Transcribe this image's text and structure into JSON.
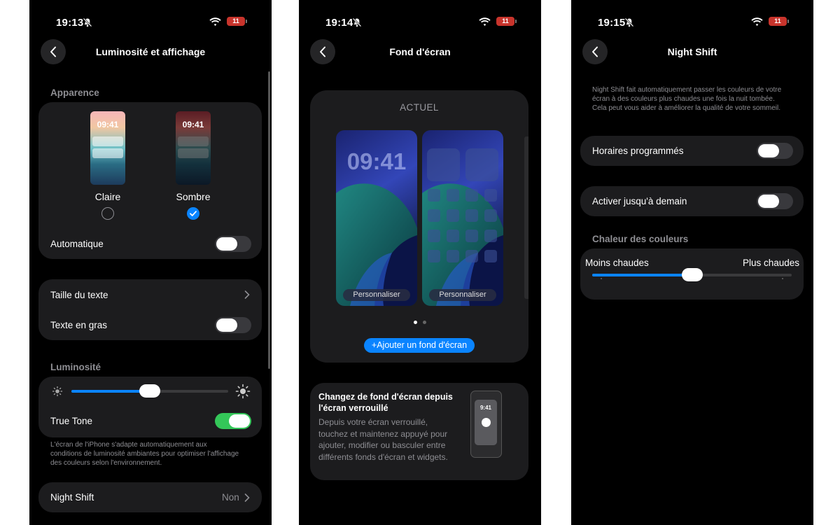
{
  "colors": {
    "accent": "#0a84ff",
    "toggle_on": "#34c759",
    "card_bg": "#1c1c1e",
    "screen_bg": "#000000",
    "battery_low": "#c8342c"
  },
  "icons": [
    "chevron-left-icon",
    "silent-bell-icon",
    "wifi-icon",
    "battery-icon",
    "chevron-right-icon",
    "sun-small-icon",
    "sun-large-icon",
    "checkmark-icon",
    "plus-icon"
  ],
  "screens": [
    {
      "status": {
        "time": "19:13",
        "battery": "11"
      },
      "nav_title": "Luminosité et affichage",
      "appearance": {
        "header": "Apparence",
        "preview_time": "09:41",
        "options": [
          {
            "label": "Claire",
            "selected": false
          },
          {
            "label": "Sombre",
            "selected": true
          }
        ],
        "automatic_label": "Automatique",
        "automatic_on": false
      },
      "text_settings": {
        "text_size_label": "Taille du texte",
        "bold_text_label": "Texte en gras",
        "bold_on": false
      },
      "brightness": {
        "header": "Luminosité",
        "level": 0.5,
        "true_tone_label": "True Tone",
        "true_tone_on": true,
        "footnote": "L'écran de l'iPhone s'adapte automatiquement aux conditions de luminosité ambiantes pour optimiser l'affichage des couleurs selon l'environnement."
      },
      "night_shift": {
        "label": "Night Shift",
        "value": "Non"
      }
    },
    {
      "status": {
        "time": "19:14",
        "battery": "11"
      },
      "nav_title": "Fond d'écran",
      "current_label": "ACTUEL",
      "lock_time": "09:41",
      "customize_label": "Personnaliser",
      "page_count": 2,
      "active_page": 0,
      "add_label": "+Ajouter un fond d'écran",
      "tip": {
        "title": "Changez de fond d'écran depuis l'écran verrouillé",
        "body": "Depuis votre écran verrouillé, touchez et maintenez appuyé pour ajouter, modifier ou basculer entre différents fonds d'écran et widgets.",
        "illustration_time": "9:41"
      }
    },
    {
      "status": {
        "time": "19:15",
        "battery": "11"
      },
      "nav_title": "Night Shift",
      "description": "Night Shift fait automatiquement passer les couleurs de votre écran à des couleurs plus chaudes une fois la nuit tombée. Cela peut vous aider à améliorer la qualité de votre sommeil.",
      "scheduled_label": "Horaires programmés",
      "scheduled_on": false,
      "until_tomorrow_label": "Activer jusqu'à demain",
      "until_tomorrow_on": false,
      "warmth": {
        "header": "Chaleur des couleurs",
        "min_label": "Moins chaudes",
        "max_label": "Plus chaudes",
        "level": 0.5
      }
    }
  ]
}
